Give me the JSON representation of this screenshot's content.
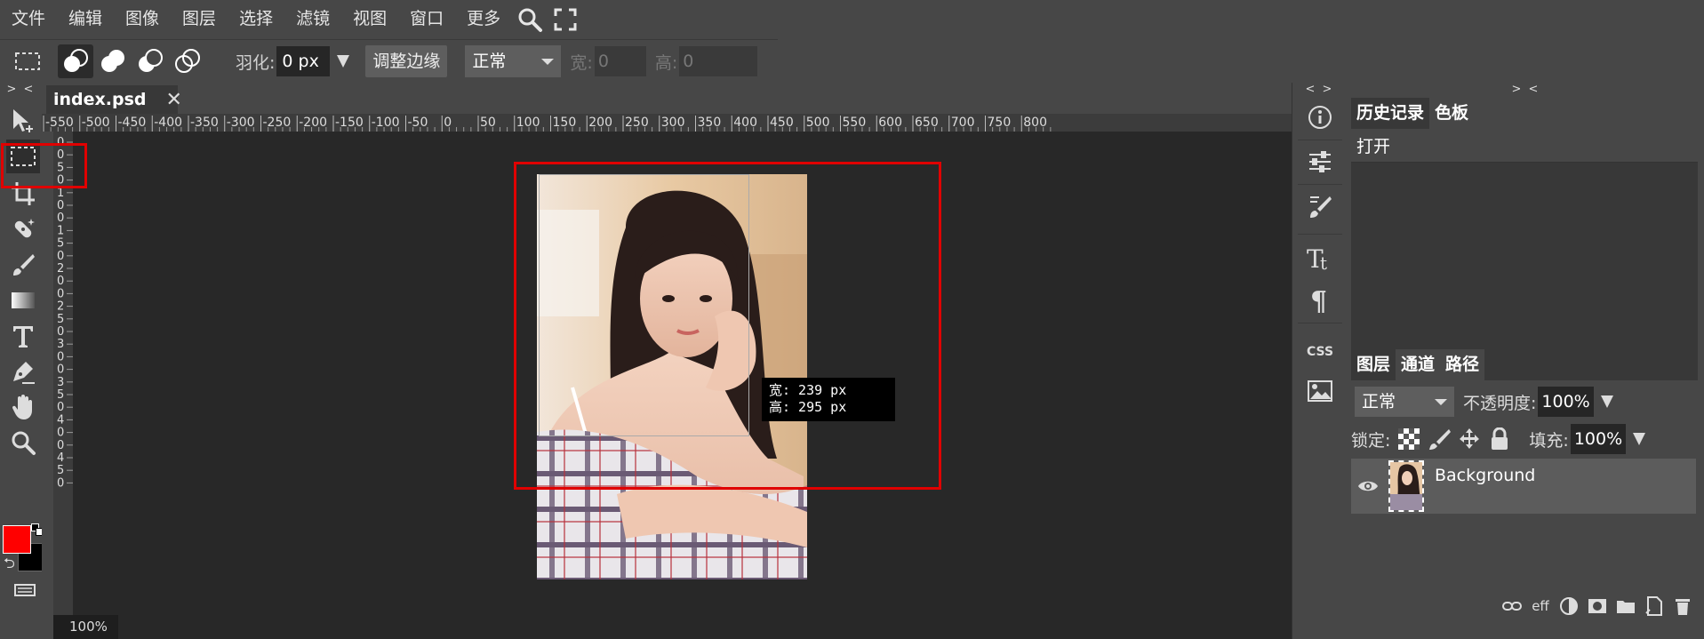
{
  "menu": [
    "文件",
    "编辑",
    "图像",
    "图层",
    "选择",
    "滤镜",
    "视图",
    "窗口",
    "更多"
  ],
  "menu_icons": [
    "search-icon",
    "fullscreen-icon"
  ],
  "options": {
    "feather_label": "羽化:",
    "feather_value": "0 px",
    "refine_edge_label": "调整边缘",
    "mode_value": "正常",
    "width_label": "宽:",
    "width_value": "0",
    "height_label": "高:",
    "height_value": "0"
  },
  "toolbar": {
    "collapse": "> <",
    "tools": [
      "move-tool",
      "rect-select-tool",
      "crop-tool",
      "healing-tool",
      "brush-tool",
      "gradient-tool",
      "type-tool",
      "pen-tool",
      "hand-tool",
      "zoom-tool"
    ],
    "foreground_color": "#ff0000",
    "background_color": "#000000"
  },
  "document": {
    "tab_name": "index.psd",
    "close_glyph": "✕",
    "zoom": "100%",
    "ruler_h_labels": [
      "-550",
      "-500",
      "-450",
      "-400",
      "-350",
      "-300",
      "-250",
      "-200",
      "-150",
      "-100",
      "-50",
      "0",
      "50",
      "100",
      "150",
      "200",
      "250",
      "300",
      "350",
      "400",
      "450",
      "500",
      "550",
      "600",
      "650",
      "700",
      "750",
      "800"
    ],
    "ruler_v_labels": [
      "0",
      "0",
      "5",
      "0",
      "1",
      "0",
      "0",
      "1",
      "5",
      "0",
      "2",
      "0",
      "0",
      "2",
      "5",
      "0",
      "3",
      "0",
      "0",
      "3",
      "5",
      "0",
      "4",
      "0",
      "0",
      "4",
      "5",
      "0"
    ],
    "size_tip_width": "宽: 239 px",
    "size_tip_height": "高: 295 px"
  },
  "right_icons": {
    "collapse": "< >",
    "icons": [
      "info-icon",
      "adjustments-icon",
      "brush-settings-icon",
      "character-icon",
      "paragraph-icon",
      "css-icon",
      "image-icon"
    ],
    "css_label": "CSS"
  },
  "panels": {
    "collapse": "> <",
    "top_tabs": [
      "历史记录",
      "色板"
    ],
    "history_items": [
      "打开"
    ],
    "layer_tabs": [
      "图层",
      "通道",
      "路径"
    ],
    "blend_mode": "正常",
    "opacity_label": "不透明度:",
    "opacity_value": "100%",
    "lock_label": "锁定:",
    "fill_label": "填充:",
    "fill_value": "100%",
    "layers": [
      {
        "name": "Background"
      }
    ],
    "footer_eff": "eff"
  },
  "colors": {
    "annotation": "#e00000",
    "panel_bg": "#474747",
    "canvas_bg": "#282828"
  }
}
